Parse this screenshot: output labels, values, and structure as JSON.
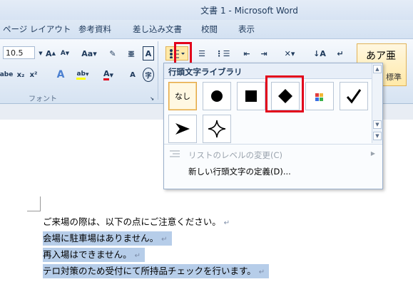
{
  "window": {
    "title": "文書 1 - Microsoft Word"
  },
  "menu": {
    "tabs": [
      "ページ レイアウト",
      "参考資料",
      "差し込み文書",
      "校閲",
      "表示"
    ]
  },
  "ribbon": {
    "font_size": "10.5",
    "font_group_label": "フォント",
    "style_sample": "あア亜",
    "style_name": "標準"
  },
  "bullet_menu": {
    "header": "行頭文字ライブラリ",
    "none_label": "なし",
    "items": [
      {
        "label": "リストのレベルの変更(C)",
        "disabled": true
      },
      {
        "label": "新しい行頭文字の定義(D)...",
        "disabled": false
      }
    ]
  },
  "document": {
    "lines": [
      {
        "text": "ご来場の際は、以下の点にご注意ください。",
        "selected": false
      },
      {
        "text": "会場に駐車場はありません。",
        "selected": true
      },
      {
        "text": "再入場はできません。",
        "selected": true
      },
      {
        "text": "テロ対策のため受付にて所持品チェックを行います。",
        "selected": true
      }
    ],
    "paragraph_mark": "↵"
  },
  "colors": {
    "highlight": "#e2001a",
    "selection": "#b6cde9"
  }
}
